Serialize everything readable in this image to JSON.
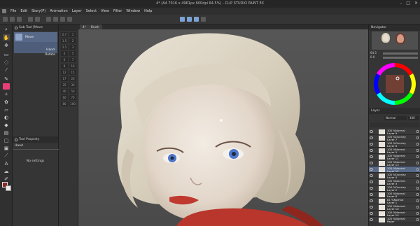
{
  "titlebar": {
    "title": "4* (A4 7016 x 4961px 600dpi 64.5%) - CLIP STUDIO PAINT EX",
    "btn_min": "–",
    "btn_max": "□",
    "btn_close": "✕"
  },
  "menu": [
    "File",
    "Edit",
    "Story(P)",
    "Animation",
    "Layer",
    "Select",
    "View",
    "Filter",
    "Window",
    "Help"
  ],
  "subtool": {
    "title": "Sub Tool [Move",
    "items": [
      "Move",
      "Hand",
      "Rotate"
    ],
    "tool_property_title": "Tool Property",
    "tool_property_name": "Hand",
    "no_settings": "No settings"
  },
  "presets": [
    "0.7",
    "1",
    "1.5",
    "2",
    "2.5",
    "3",
    "4",
    "5",
    "6",
    "7",
    "8",
    "10",
    "12",
    "15",
    "17",
    "20",
    "25",
    "30",
    "40",
    "50",
    "60",
    "70",
    "80",
    "100"
  ],
  "canvas": {
    "tab": "Brush",
    "small_tab": "4*"
  },
  "navigator": {
    "title": "Navigator",
    "zoom": "64.5",
    "angle": "0.0"
  },
  "layers": {
    "title": "Layer",
    "blend": "Normal",
    "opacity": "100",
    "items": [
      [
        "100 %Normal",
        "Layer 9"
      ],
      [
        "100 %Overlay",
        "Layer 7"
      ],
      [
        "100 %Overlay",
        "Layer 6"
      ],
      [
        "100 %Normal",
        "Layer 5"
      ],
      [
        "100 %Normal",
        "Layer 11"
      ],
      [
        "100 %Normal",
        "Layer 13"
      ],
      [
        "100 %Normal",
        "Layer 12"
      ],
      [
        "100 %Overlay",
        "Layer 4"
      ],
      [
        "100 %Normal",
        "Layer 3"
      ],
      [
        "100 %Overlay",
        "Layer 2"
      ],
      [
        "100 %Normal",
        "Layer 8"
      ],
      [
        "81 %Normal",
        "Layer 1"
      ],
      [
        "100 %Normal",
        "Layer 10"
      ],
      [
        "100 %Normal",
        "Layer 14"
      ],
      [
        "100 %Normal",
        "Paper"
      ]
    ],
    "selected_index": 6
  },
  "colors": {
    "main": "#8a2a24",
    "sub": "#f2efe9"
  }
}
